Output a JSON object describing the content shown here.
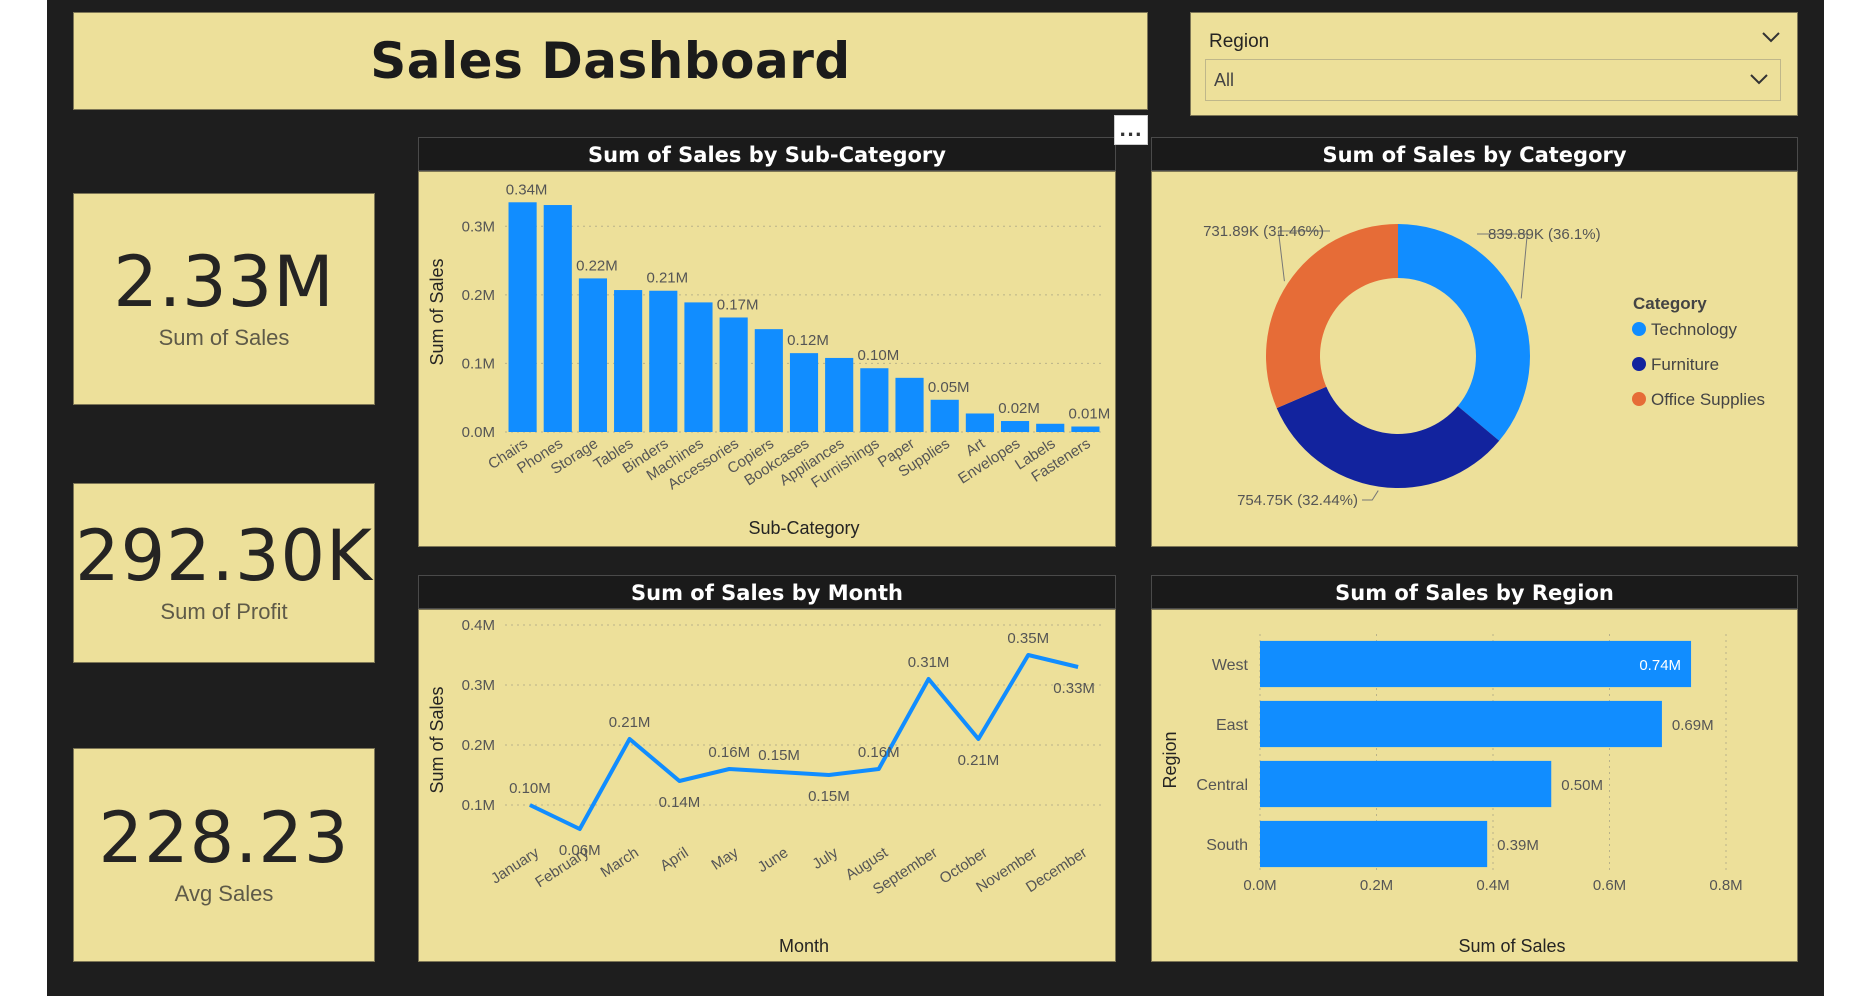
{
  "header": {
    "title": "Sales Dashboard"
  },
  "slicer": {
    "label": "Region",
    "value": "All"
  },
  "kpis": [
    {
      "value": "2.33M",
      "label": "Sum of Sales"
    },
    {
      "value": "292.30K",
      "label": "Sum of Profit"
    },
    {
      "value": "228.23",
      "label": "Avg Sales"
    }
  ],
  "more_options": "...",
  "colors": {
    "bar": "#118dff",
    "panel": "#ede09a",
    "background": "#1e1e1e",
    "technology": "#118dff",
    "furniture": "#12239e",
    "office_supplies": "#e66c37"
  },
  "chart_data": [
    {
      "type": "bar",
      "title": "Sum of Sales by Sub-Category",
      "xlabel": "Sub-Category",
      "ylabel": "Sum of Sales",
      "ylim": [
        0,
        0.35
      ],
      "yticks": [
        "0.0M",
        "0.1M",
        "0.2M",
        "0.3M"
      ],
      "categories": [
        "Chairs",
        "Phones",
        "Storage",
        "Tables",
        "Binders",
        "Machines",
        "Accessories",
        "Copiers",
        "Bookcases",
        "Appliances",
        "Furnishings",
        "Paper",
        "Supplies",
        "Art",
        "Envelopes",
        "Labels",
        "Fasteners"
      ],
      "values": [
        0.335,
        0.331,
        0.224,
        0.207,
        0.206,
        0.189,
        0.167,
        0.15,
        0.115,
        0.108,
        0.093,
        0.079,
        0.047,
        0.027,
        0.016,
        0.012,
        0.008
      ],
      "data_labels": [
        "0.34M",
        "",
        "0.22M",
        "",
        "0.21M",
        "",
        "0.17M",
        "",
        "0.12M",
        "",
        "0.10M",
        "",
        "0.05M",
        "",
        "0.02M",
        "",
        "0.01M"
      ]
    },
    {
      "type": "pie",
      "title": "Sum of Sales by Category",
      "legend_title": "Category",
      "legend_position": "right",
      "slices": [
        {
          "name": "Technology",
          "value": 839.89,
          "label": "839.89K (36.1%)",
          "color": "#118dff"
        },
        {
          "name": "Furniture",
          "value": 754.75,
          "label": "754.75K (32.44%)",
          "color": "#12239e"
        },
        {
          "name": "Office Supplies",
          "value": 731.89,
          "label": "731.89K (31.46%)",
          "color": "#e66c37"
        }
      ]
    },
    {
      "type": "line",
      "title": "Sum of Sales by Month",
      "xlabel": "Month",
      "ylabel": "Sum of Sales",
      "ylim": [
        0.05,
        0.4
      ],
      "yticks": [
        "0.1M",
        "0.2M",
        "0.3M",
        "0.4M"
      ],
      "categories": [
        "January",
        "February",
        "March",
        "April",
        "May",
        "June",
        "July",
        "August",
        "September",
        "October",
        "November",
        "December"
      ],
      "values": [
        0.1,
        0.06,
        0.21,
        0.14,
        0.16,
        0.155,
        0.15,
        0.16,
        0.31,
        0.21,
        0.35,
        0.33
      ],
      "data_labels": [
        "0.10M",
        "0.06M",
        "0.21M",
        "0.14M",
        "0.16M",
        "0.15M",
        "0.15M",
        "0.16M",
        "0.31M",
        "0.21M",
        "0.35M",
        "0.33M"
      ]
    },
    {
      "type": "bar",
      "orientation": "horizontal",
      "title": "Sum of Sales by Region",
      "xlabel": "Sum of Sales",
      "ylabel": "Region",
      "xlim": [
        0,
        0.8
      ],
      "xticks": [
        "0.0M",
        "0.2M",
        "0.4M",
        "0.6M",
        "0.8M"
      ],
      "categories": [
        "West",
        "East",
        "Central",
        "South"
      ],
      "values": [
        0.74,
        0.69,
        0.5,
        0.39
      ],
      "data_labels": [
        "0.74M",
        "0.69M",
        "0.50M",
        "0.39M"
      ]
    }
  ]
}
